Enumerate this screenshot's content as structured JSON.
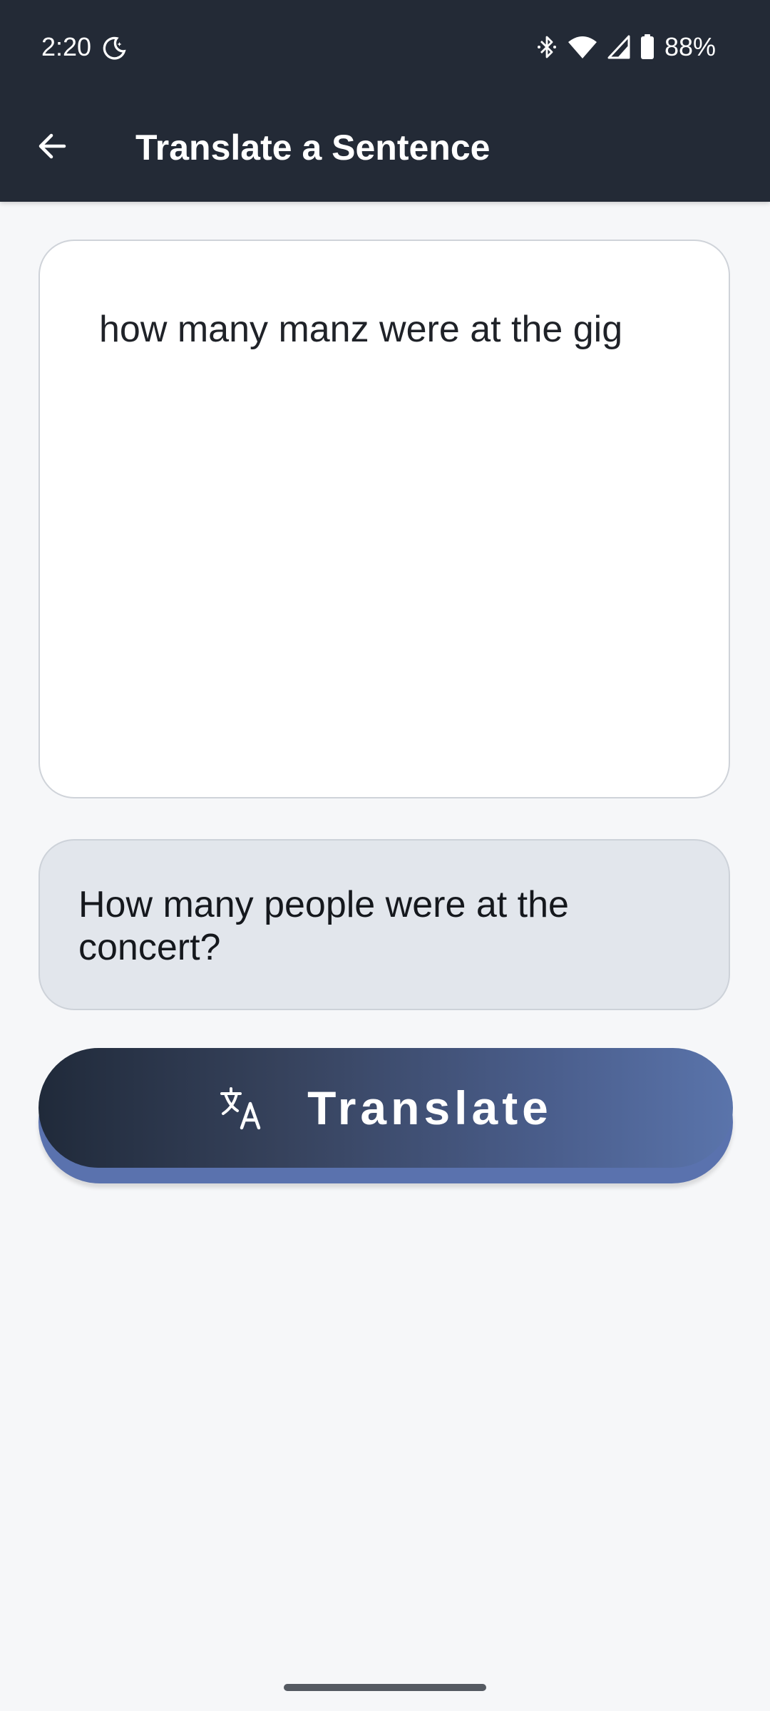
{
  "status_bar": {
    "time": "2:20",
    "battery": "88%",
    "icons": [
      "moon-icon",
      "bluetooth-icon",
      "wifi-icon",
      "cell-signal-icon",
      "battery-icon"
    ]
  },
  "app_bar": {
    "title": "Translate a Sentence",
    "back_icon": "arrow-left-icon"
  },
  "input": {
    "value": "how many manz were at the gig"
  },
  "output": {
    "text": "How many people were at the concert?"
  },
  "translate_button": {
    "label": "Translate",
    "icon": "translate-icon"
  },
  "colors": {
    "header_bg": "#232a36",
    "page_bg": "#f6f7f9",
    "output_bg": "#e2e6ec",
    "button_gradient_start": "#202a3a",
    "button_gradient_end": "#5a74ab"
  }
}
